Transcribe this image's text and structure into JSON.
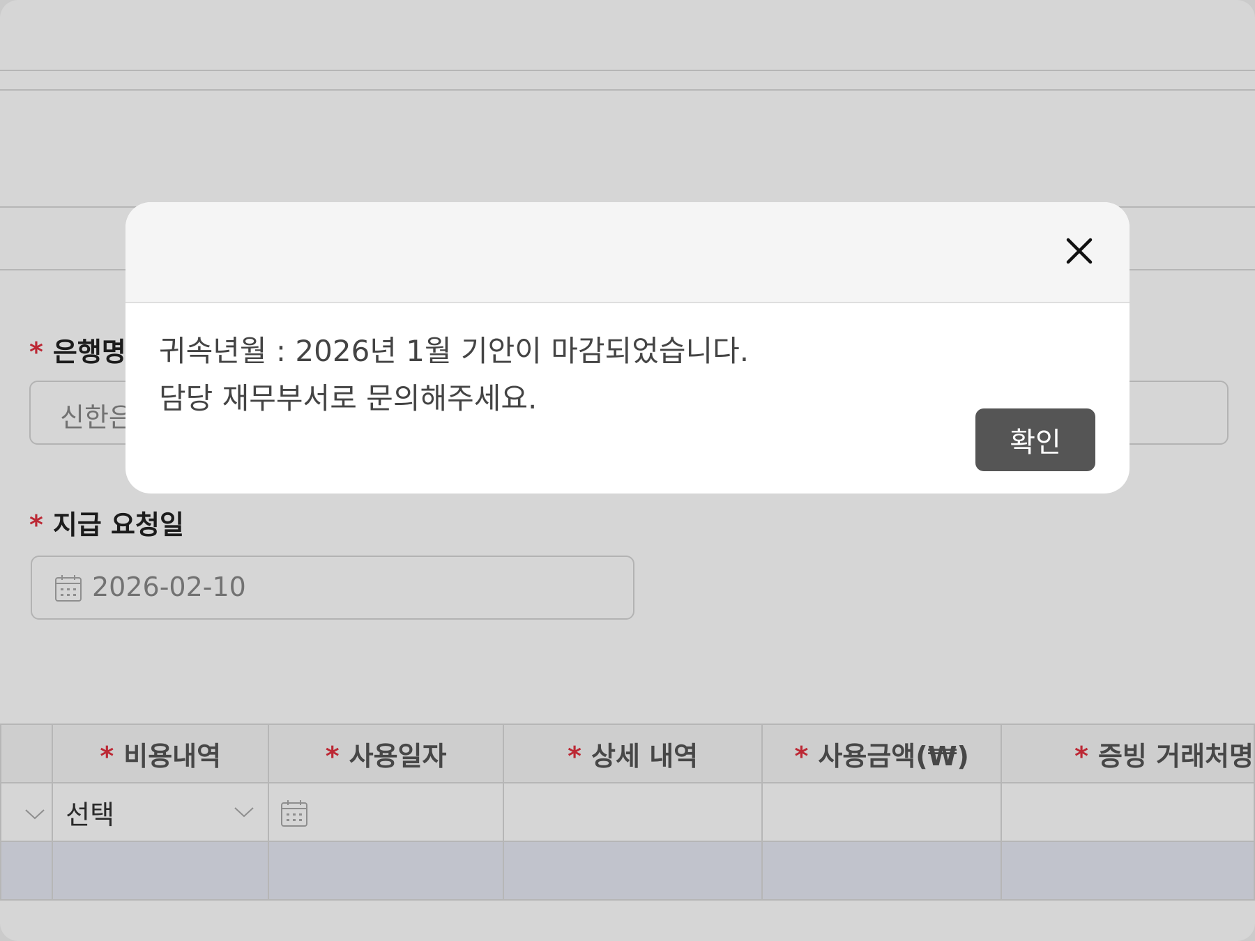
{
  "form": {
    "bank": {
      "label": "은행명",
      "value": "신한은"
    },
    "pay_date": {
      "label": "지급 요청일",
      "value": "2026-02-10"
    },
    "required_mark": "*"
  },
  "table": {
    "columns": [
      "비용내역",
      "사용일자",
      "상세 내역",
      "사용금액(₩)",
      "증빙 거래처명"
    ],
    "row": {
      "expense_type": "선택"
    }
  },
  "modal": {
    "line1": "귀속년월 : 2026년 1월 기안이 마감되었습니다.",
    "line2": "담당 재무부서로 문의해주세요.",
    "confirm_label": "확인"
  }
}
